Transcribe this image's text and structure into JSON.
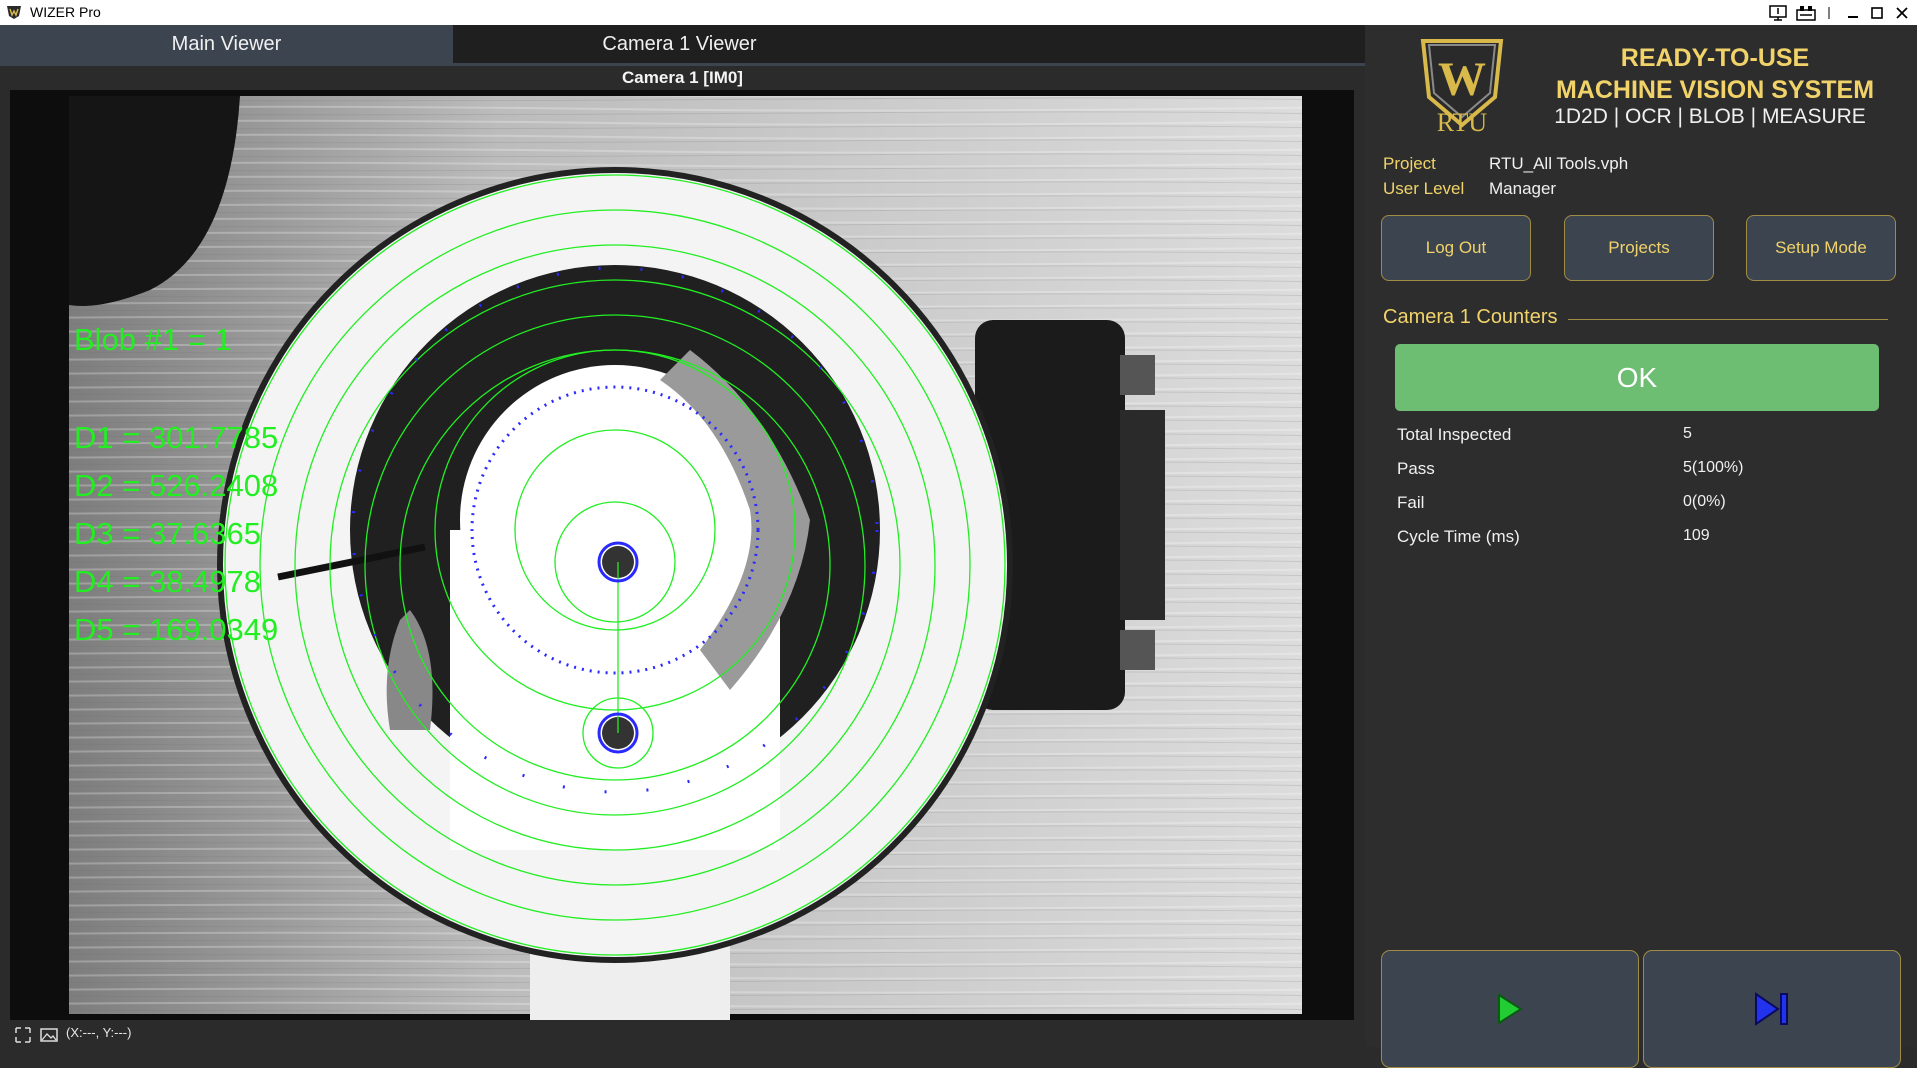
{
  "window": {
    "title": "WIZER Pro"
  },
  "tabs": [
    {
      "label": "Main Viewer",
      "active": true
    },
    {
      "label": "Camera 1 Viewer",
      "active": false
    }
  ],
  "viewer": {
    "title": "Camera 1  [IM0]",
    "overlay": {
      "blob": "Blob #1 = 1",
      "d1": "D1 = 301.7785",
      "d2": "D2 = 526.2408",
      "d3": "D3 = 37.6365",
      "d4": "D4 = 38.4978",
      "d5": "D5 = 169.0349"
    }
  },
  "status_bar": {
    "coords": "(X:---, Y:---)"
  },
  "brand": {
    "headline_1": "READY-TO-USE",
    "headline_2": "MACHINE VISION SYSTEM",
    "tools": "1D2D | OCR | BLOB | MEASURE",
    "logo_text": "RTU",
    "logo_letter": "W"
  },
  "project": {
    "project_label": "Project",
    "project_value": "RTU_All Tools.vph",
    "user_level_label": "User Level",
    "user_level_value": "Manager"
  },
  "buttons": {
    "logout": "Log Out",
    "projects": "Projects",
    "setup": "Setup Mode"
  },
  "counters": {
    "title": "Camera 1 Counters",
    "status": "OK",
    "status_color": "#6dbd72",
    "rows": [
      {
        "label": "Total Inspected",
        "value": "5"
      },
      {
        "label": "Pass",
        "value": "5(100%)"
      },
      {
        "label": "Fail",
        "value": "0(0%)"
      },
      {
        "label": "Cycle Time (ms)",
        "value": "109"
      }
    ]
  },
  "controls": {
    "run_icon": "play-icon",
    "step_icon": "step-forward-icon"
  },
  "colors": {
    "accent": "#f1d36a",
    "overlay_green": "#22ee22",
    "button_bg": "#3c4450"
  }
}
